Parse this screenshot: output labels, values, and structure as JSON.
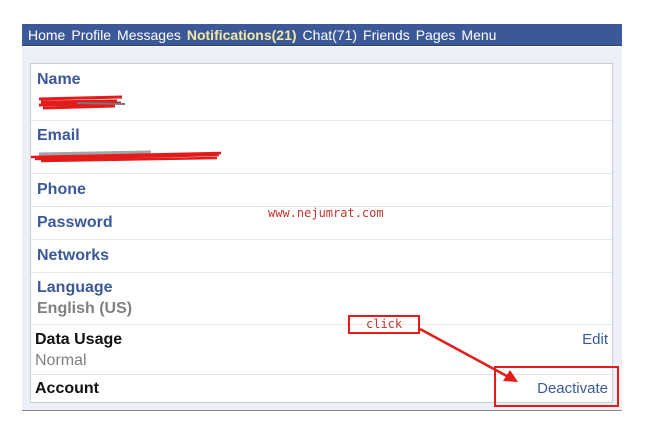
{
  "nav": {
    "items": [
      {
        "label": "Home",
        "active": false
      },
      {
        "label": "Profile",
        "active": false
      },
      {
        "label": "Messages",
        "active": false
      },
      {
        "label": "Notifications(21)",
        "active": true
      },
      {
        "label": "Chat(71)",
        "active": false
      },
      {
        "label": "Friends",
        "active": false
      },
      {
        "label": "Pages",
        "active": false
      },
      {
        "label": "Menu",
        "active": false
      }
    ]
  },
  "settings": {
    "name_label": "Name",
    "email_label": "Email",
    "phone_label": "Phone",
    "password_label": "Password",
    "networks_label": "Networks",
    "language_label": "Language",
    "language_value": "English (US)",
    "data_usage_label": "Data Usage",
    "data_usage_value": "Normal",
    "data_usage_action": "Edit",
    "account_label": "Account",
    "account_action": "Deactivate"
  },
  "annotations": {
    "watermark": "www.nejumrat.com",
    "click_label": "click"
  },
  "colors": {
    "brand": "#3b5998",
    "nav_active": "#f4e9a3",
    "annotation_red": "#e41b1b"
  }
}
